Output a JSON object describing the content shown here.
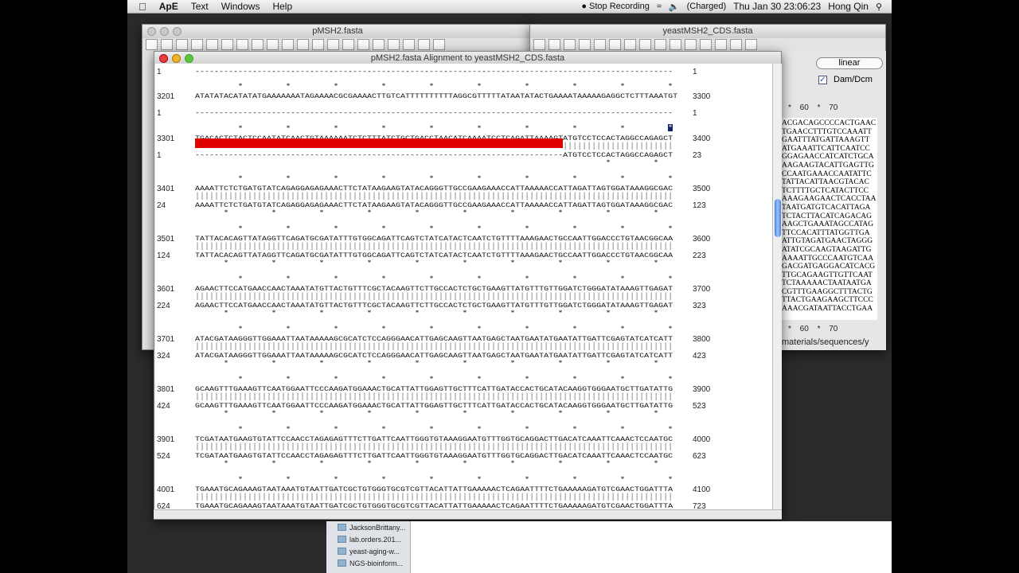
{
  "menubar": {
    "app": "ApE",
    "items": [
      "Text",
      "Windows",
      "Help"
    ],
    "recording": "Stop Recording",
    "battery": "(Charged)",
    "clock": "Thu Jan 30  23:06:23",
    "user": "Hong Qin"
  },
  "windows": {
    "left_title": "pMSH2.fasta",
    "right_title": "yeastMSH2_CDS.fasta",
    "alignment_title": "pMSH2.fasta Alignment to yeastMSH2_CDS.fasta"
  },
  "right_panel": {
    "topology": "linear",
    "dam_dcm_label": "Dam/Dcm",
    "dam_dcm_checked": true,
    "ruler": "*  60  *  70",
    "path": "materials/sequences/y",
    "sequence_lines": [
      "ACGACAGCCCCACTGAAC",
      "TGAACCTTTGTCCAAATT",
      "GAATTTATGATTAAAGTT",
      "ATGAAATTCATTCAATCC",
      "GGAGAACCATCATCTGCA",
      "AAGAAGTACATTGAGTTG",
      "CCAATGAAACCAATATTC",
      "TATTACATTAACGTACAC",
      "TCTTTTGCTCATACTTCC",
      "AAAGAAGAACTCACCTAA",
      "TAATGATGTCACATTAGA",
      "TCTACTTACATCAGACAG",
      "AAGCTGAAATAGCCATAG",
      "TTCCACATTTATGGTTGA",
      "ATTGTAGATGAACTAGGG",
      "ATATCGCAAGTAAGATTG",
      "AAAATTGCCCAATGTCAA",
      "GACGATGAGGACATCACG",
      "TTGCAGAAGTTGTTCAAT",
      "TCTAAAAACTAATAATGA",
      "CGTTTGAAGGCTTTACTG",
      "TTACTGAAGAAGCTTCCC",
      "AAACGATAATTACCTGAA"
    ]
  },
  "alignment": {
    "leading_bottom": {
      "start": "1",
      "seq": "----------------------------------------------------------------------------------------------------",
      "end": "1"
    },
    "mismatch_color": "#e00000",
    "blocks": [
      {
        "top_start": "3201",
        "top_seq": "ATATATACATATATGAAAAAAATAGAAAACGCGAAAACTTGTCATTTTTTTTTTAGGCGTTTTTATAATATACTGAAAATAAAAAGAGGCTCTTTAAATGT",
        "top_end": "3300",
        "bottom_start": "1",
        "bottom_seq": "----------------------------------------------------------------------------------------------------",
        "bottom_end": "1"
      },
      {
        "top_start": "3301",
        "top_seq": "TGACACTCTACTCCAATATCAACTGTAAAAAATCTCTTTATCTGCTGACCTAACATCAAAATCCTCAGATTAAAAGTATGTCCTCCACTAGGCCAGAGCT",
        "top_end": "3400",
        "bottom_start": "1",
        "bottom_seq": "-----------------------------------------------------------------------------ATGTCCTCCACTAGGCCAGAGCT",
        "bottom_end": "23"
      },
      {
        "top_start": "3401",
        "top_seq": "AAAATTCTCTGATGTATCAGAGGAGAGAAACTTCTATAAGAAGTATACAGGGTTGCCGAAGAAACCATTAAAAACCATTAGATTAGTGGATAAAGGCGAC",
        "top_end": "3500",
        "bottom_start": "24",
        "bottom_seq": "AAAATTCTCTGATGTATCAGAGGAGAGAAACTTCTATAAGAAGTATACAGGGTTGCCGAAGAAACCATTAAAAACCATTAGATTAGTGGATAAAGGCGAC",
        "bottom_end": "123"
      },
      {
        "top_start": "3501",
        "top_seq": "TATTACACAGTTATAGGTTCAGATGCGATATTTGTGGCAGATTCAGTCTATCATACTCAATCTGTTTTAAAGAACTGCCAATTGGACCCTGTAACGGCAA",
        "top_end": "3600",
        "bottom_start": "124",
        "bottom_seq": "TATTACACAGTTATAGGTTCAGATGCGATATTTGTGGCAGATTCAGTCTATCATACTCAATCTGTTTTAAAGAACTGCCAATTGGACCCTGTAACGGCAA",
        "bottom_end": "223"
      },
      {
        "top_start": "3601",
        "top_seq": "AGAACTTCCATGAACCAACTAAATATGTTACTGTTTCGCTACAAGTTCTTGCCACTCTGCTGAAGTTATGTTTGTTGGATCTGGGATATAAAGTTGAGAT",
        "top_end": "3700",
        "bottom_start": "224",
        "bottom_seq": "AGAACTTCCATGAACCAACTAAATATGTTACTGTTTCGCTACAAGTTCTTGCCACTCTGCTGAAGTTATGTTTGTTGGATCTGGGATATAAAGTTGAGAT",
        "bottom_end": "323"
      },
      {
        "top_start": "3701",
        "top_seq": "ATACGATAAGGGTTGGAAATTAATAAAAAGCGCATCTCCAGGGAACATTGAGCAAGTTAATGAGCTAATGAATATGAATATTGATTCGAGTATCATCATT",
        "top_end": "3800",
        "bottom_start": "324",
        "bottom_seq": "ATACGATAAGGGTTGGAAATTAATAAAAAGCGCATCTCCAGGGAACATTGAGCAAGTTAATGAGCTAATGAATATGAATATTGATTCGAGTATCATCATT",
        "bottom_end": "423"
      },
      {
        "top_start": "3801",
        "top_seq": "GCAAGTTTGAAAGTTCAATGGAATTCCCAAGATGGAAACTGCATTATTGGAGTTGCTTTCATTGATACCACTGCATACAAGGTGGGAATGCTTGATATTG",
        "top_end": "3900",
        "bottom_start": "424",
        "bottom_seq": "GCAAGTTTGAAAGTTCAATGGAATTCCCAAGATGGAAACTGCATTATTGGAGTTGCTTTCATTGATACCACTGCATACAAGGTGGGAATGCTTGATATTG",
        "bottom_end": "523"
      },
      {
        "top_start": "3901",
        "top_seq": "TCGATAATGAAGTGTATTCCAACCTAGAGAGTTTCTTGATTCAATTGGGTGTAAAGGAATGTTTGGTGCAGGACTTGACATCAAATTCAAACTCCAATGC",
        "top_end": "4000",
        "bottom_start": "524",
        "bottom_seq": "TCGATAATGAAGTGTATTCCAACCTAGAGAGTTTCTTGATTCAATTGGGTGTAAAGGAATGTTTGGTGCAGGACTTGACATCAAATTCAAACTCCAATGC",
        "bottom_end": "623"
      },
      {
        "top_start": "4001",
        "top_seq": "TGAAATGCAGAAAGTAATAAATGTAATTGATCGCTGTGGGTGCGTCGTTACATTATTGAAAAACTCAGAATTTTCTGAAAAAGATGTCGAACTGGATTTA",
        "top_end": "4100",
        "bottom_start": "624",
        "bottom_seq": "TGAAATGCAGAAAGTAATAAATGTAATTGATCGCTGTGGGTGCGTCGTTACATTATTGAAAAACTCAGAATTTTCTGAAAAAGATGTCGAACTGGATTTA",
        "bottom_end": "723"
      }
    ]
  },
  "finder": {
    "items": [
      "JacksonBrittany...",
      "lab.orders.201...",
      "yeast-aging-w...",
      "NGS-bioinform..."
    ]
  }
}
